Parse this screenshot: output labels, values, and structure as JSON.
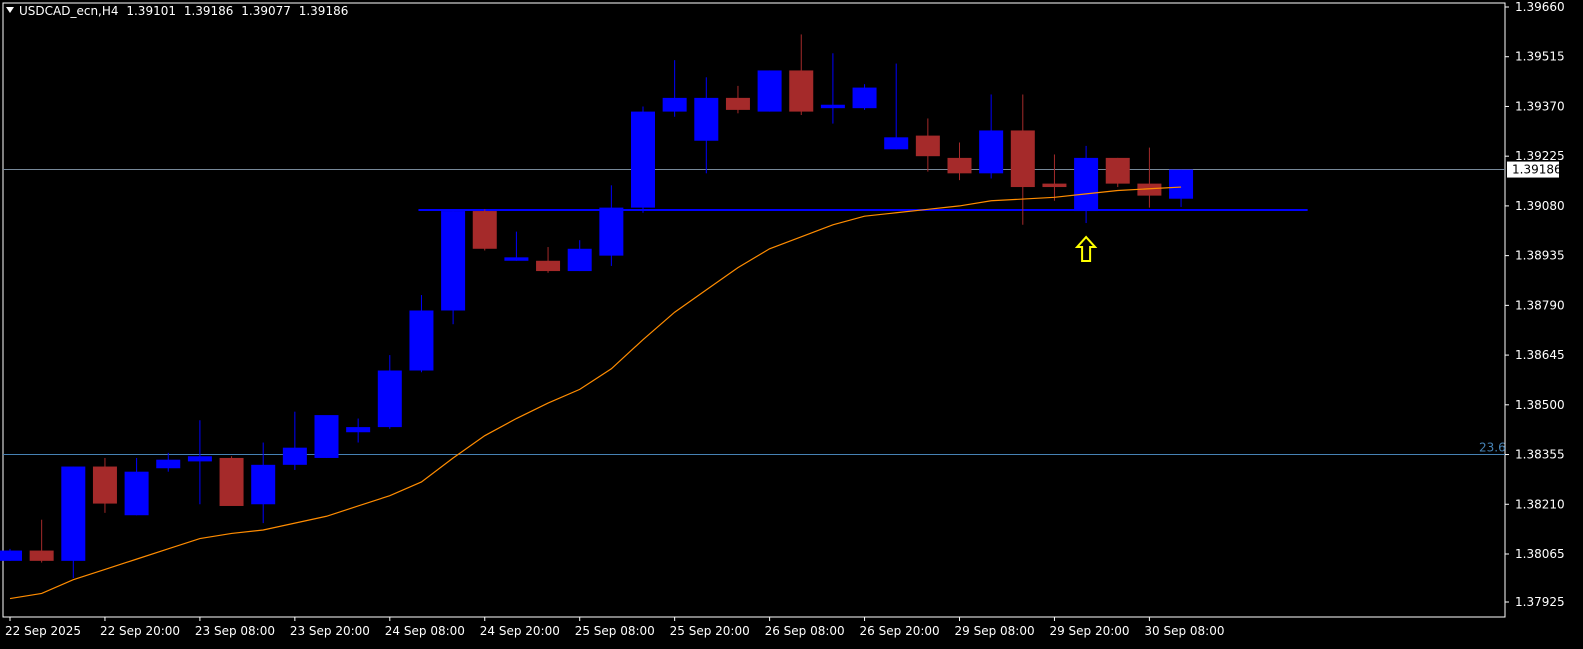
{
  "header": {
    "symbol": "USDCAD_ecn,H4",
    "open": "1.39101",
    "high": "1.39186",
    "low": "1.39077",
    "close": "1.39186"
  },
  "colors": {
    "background": "#000000",
    "bull": "#0000ff",
    "bear": "#a52a2a",
    "wick_bull": "#0000ff",
    "wick_bear": "#a52a2a",
    "ma": "#ff8c00",
    "support": "#0000ff",
    "price_line": "#778899",
    "fib": "#4682b4",
    "arrow": "#ffff00"
  },
  "chart_data": {
    "type": "candlestick",
    "symbol": "USDCAD_ecn",
    "timeframe": "H4",
    "ylim": [
      1.37925,
      1.3966
    ],
    "y_ticks": [
      "1.39660",
      "1.39515",
      "1.39370",
      "1.39225",
      "1.39080",
      "1.38935",
      "1.38790",
      "1.38645",
      "1.38500",
      "1.38355",
      "1.38210",
      "1.38065",
      "1.37925"
    ],
    "x_labels": [
      "22 Sep 2025",
      "22 Sep 20:00",
      "23 Sep 08:00",
      "23 Sep 20:00",
      "24 Sep 08:00",
      "24 Sep 20:00",
      "25 Sep 08:00",
      "25 Sep 20:00",
      "26 Sep 08:00",
      "26 Sep 20:00",
      "29 Sep 08:00",
      "29 Sep 20:00",
      "30 Sep 08:00"
    ],
    "current_price": "1.39186",
    "support_level": 1.39068,
    "fib_level": {
      "label": "23.6",
      "value": 1.38355
    },
    "candles": [
      {
        "o": 1.38045,
        "h": 1.3808,
        "l": 1.38045,
        "c": 1.38075
      },
      {
        "o": 1.38075,
        "h": 1.38165,
        "l": 1.3804,
        "c": 1.38045
      },
      {
        "o": 1.38045,
        "h": 1.3832,
        "l": 1.37995,
        "c": 1.3832
      },
      {
        "o": 1.3832,
        "h": 1.38345,
        "l": 1.38185,
        "c": 1.38212
      },
      {
        "o": 1.38178,
        "h": 1.38345,
        "l": 1.38178,
        "c": 1.38305
      },
      {
        "o": 1.38315,
        "h": 1.3836,
        "l": 1.38305,
        "c": 1.3834
      },
      {
        "o": 1.38335,
        "h": 1.38455,
        "l": 1.3821,
        "c": 1.3835
      },
      {
        "o": 1.38345,
        "h": 1.3835,
        "l": 1.3821,
        "c": 1.38205
      },
      {
        "o": 1.3821,
        "h": 1.3839,
        "l": 1.38155,
        "c": 1.38325
      },
      {
        "o": 1.38325,
        "h": 1.3848,
        "l": 1.3831,
        "c": 1.38375
      },
      {
        "o": 1.38345,
        "h": 1.38435,
        "l": 1.38345,
        "c": 1.3847
      },
      {
        "o": 1.3842,
        "h": 1.3846,
        "l": 1.3839,
        "c": 1.38435
      },
      {
        "o": 1.38435,
        "h": 1.38645,
        "l": 1.3843,
        "c": 1.386
      },
      {
        "o": 1.386,
        "h": 1.3882,
        "l": 1.38595,
        "c": 1.38775
      },
      {
        "o": 1.38775,
        "h": 1.3907,
        "l": 1.38735,
        "c": 1.39065
      },
      {
        "o": 1.39065,
        "h": 1.3907,
        "l": 1.3895,
        "c": 1.38955
      },
      {
        "o": 1.3892,
        "h": 1.39005,
        "l": 1.3892,
        "c": 1.3893
      },
      {
        "o": 1.3892,
        "h": 1.3896,
        "l": 1.38885,
        "c": 1.3889
      },
      {
        "o": 1.3889,
        "h": 1.3898,
        "l": 1.3889,
        "c": 1.38955
      },
      {
        "o": 1.38935,
        "h": 1.3914,
        "l": 1.38905,
        "c": 1.39075
      },
      {
        "o": 1.39075,
        "h": 1.3937,
        "l": 1.3906,
        "c": 1.39355
      },
      {
        "o": 1.39355,
        "h": 1.39505,
        "l": 1.3934,
        "c": 1.39395
      },
      {
        "o": 1.3927,
        "h": 1.39455,
        "l": 1.39175,
        "c": 1.39395
      },
      {
        "o": 1.39395,
        "h": 1.3943,
        "l": 1.3935,
        "c": 1.3936
      },
      {
        "o": 1.39355,
        "h": 1.39475,
        "l": 1.39355,
        "c": 1.39475
      },
      {
        "o": 1.39475,
        "h": 1.3958,
        "l": 1.39345,
        "c": 1.39355
      },
      {
        "o": 1.39365,
        "h": 1.39525,
        "l": 1.3932,
        "c": 1.39375
      },
      {
        "o": 1.39365,
        "h": 1.39435,
        "l": 1.3936,
        "c": 1.39425
      },
      {
        "o": 1.39245,
        "h": 1.39495,
        "l": 1.39245,
        "c": 1.3928
      },
      {
        "o": 1.39285,
        "h": 1.39335,
        "l": 1.3918,
        "c": 1.39225
      },
      {
        "o": 1.3922,
        "h": 1.39265,
        "l": 1.39155,
        "c": 1.39175
      },
      {
        "o": 1.39175,
        "h": 1.39405,
        "l": 1.3916,
        "c": 1.393
      },
      {
        "o": 1.393,
        "h": 1.39405,
        "l": 1.39025,
        "c": 1.39135
      },
      {
        "o": 1.39145,
        "h": 1.3923,
        "l": 1.39095,
        "c": 1.39135
      },
      {
        "o": 1.39065,
        "h": 1.39255,
        "l": 1.3903,
        "c": 1.3922
      },
      {
        "o": 1.3922,
        "h": 1.3922,
        "l": 1.39135,
        "c": 1.39145
      },
      {
        "o": 1.39145,
        "h": 1.3925,
        "l": 1.39075,
        "c": 1.3911
      },
      {
        "o": 1.39101,
        "h": 1.39186,
        "l": 1.39077,
        "c": 1.39186
      }
    ],
    "ma": [
      1.37935,
      1.3795,
      1.3799,
      1.3802,
      1.3805,
      1.3808,
      1.3811,
      1.38125,
      1.38135,
      1.38155,
      1.38175,
      1.38205,
      1.38235,
      1.38275,
      1.38345,
      1.3841,
      1.3846,
      1.38505,
      1.38545,
      1.38605,
      1.3869,
      1.3877,
      1.38835,
      1.389,
      1.38955,
      1.3899,
      1.39025,
      1.3905,
      1.3906,
      1.3907,
      1.3908,
      1.39095,
      1.391,
      1.39105,
      1.39115,
      1.39125,
      1.3913,
      1.39135
    ],
    "annotation": {
      "type": "up-arrow",
      "candle_index": 34
    }
  }
}
